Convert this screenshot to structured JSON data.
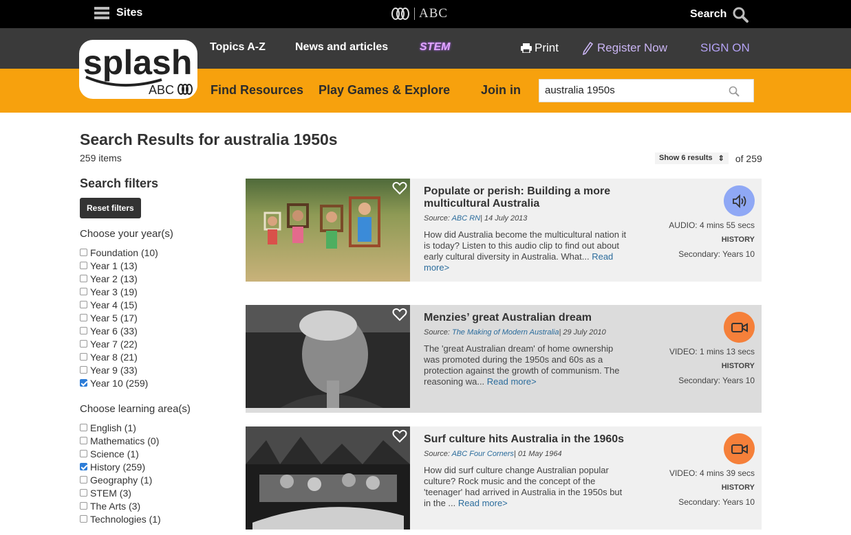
{
  "topbar": {
    "sites": "Sites",
    "brand": "ABC",
    "search": "Search"
  },
  "nav": {
    "topics": "Topics A-Z",
    "news": "News and articles",
    "stem": "STEM",
    "print": "Print",
    "register": "Register Now",
    "sign_on": "SIGN ON"
  },
  "logo": {
    "word": "splash",
    "sub": "ABC"
  },
  "orange": {
    "find": "Find Resources",
    "play": "Play Games & Explore",
    "join": "Join in",
    "search_value": "australia 1950s"
  },
  "results": {
    "title": "Search Results for australia 1950s",
    "count": "259 items",
    "show": "Show 6 results",
    "of": "of 259"
  },
  "filters": {
    "title": "Search filters",
    "reset": "Reset filters",
    "year_label": "Choose your year(s)",
    "years": [
      {
        "label": "Foundation (10)",
        "checked": false
      },
      {
        "label": "Year 1 (13)",
        "checked": false
      },
      {
        "label": "Year 2 (13)",
        "checked": false
      },
      {
        "label": "Year 3 (19)",
        "checked": false
      },
      {
        "label": "Year 4 (15)",
        "checked": false
      },
      {
        "label": "Year 5 (17)",
        "checked": false
      },
      {
        "label": "Year 6 (33)",
        "checked": false
      },
      {
        "label": "Year 7 (22)",
        "checked": false
      },
      {
        "label": "Year 8 (21)",
        "checked": false
      },
      {
        "label": "Year 9 (33)",
        "checked": false
      },
      {
        "label": "Year 10 (259)",
        "checked": true
      }
    ],
    "area_label": "Choose learning area(s)",
    "areas": [
      {
        "label": "English (1)",
        "checked": false
      },
      {
        "label": "Mathematics (0)",
        "checked": false
      },
      {
        "label": "Science (1)",
        "checked": false
      },
      {
        "label": "History (259)",
        "checked": true
      },
      {
        "label": "Geography (1)",
        "checked": false
      },
      {
        "label": "STEM (3)",
        "checked": false
      },
      {
        "label": "The Arts (3)",
        "checked": false
      },
      {
        "label": "Technologies (1)",
        "checked": false
      }
    ]
  },
  "cards": [
    {
      "title": "Populate or perish: Building a more multicultural Australia",
      "source_prefix": "Source: ",
      "source": "ABC RN",
      "date": "| 14 July 2013",
      "desc": "How did Australia become the multicultural nation it is today? Listen to this audio clip to find out about early cultural diversity in Australia. What... ",
      "read_more": "Read more>",
      "type": "AUDIO: 4 mins 55 secs",
      "subject": "HISTORY",
      "level": "Secondary: Years 10",
      "icon": "speaker-icon",
      "icon_color": "#8fa8f5"
    },
    {
      "title": "Menzies’ great Australian dream",
      "source_prefix": "Source: ",
      "source": "The Making of Modern Australia",
      "date": "| 29 July 2010",
      "desc": "The 'great Australian dream' of home ownership was promoted during the 1950s and 60s as a protection against the growth of communism. The reasoning wa... ",
      "read_more": "Read more>",
      "type": "VIDEO: 1 mins 13 secs",
      "subject": "HISTORY",
      "level": "Secondary: Years 10",
      "icon": "video-camera-icon",
      "icon_color": "#f5803a"
    },
    {
      "title": "Surf culture hits Australia in the 1960s",
      "source_prefix": "Source: ",
      "source": "ABC Four Corners",
      "date": "| 01 May 1964",
      "desc": "How did surf culture change Australian popular culture? Rock music and the concept of the 'teenager' had arrived in Australia in the 1950s but in the ... ",
      "read_more": "Read more>",
      "type": "VIDEO: 4 mins 39 secs",
      "subject": "HISTORY",
      "level": "Secondary: Years 10",
      "icon": "video-camera-icon",
      "icon_color": "#f5803a"
    }
  ]
}
